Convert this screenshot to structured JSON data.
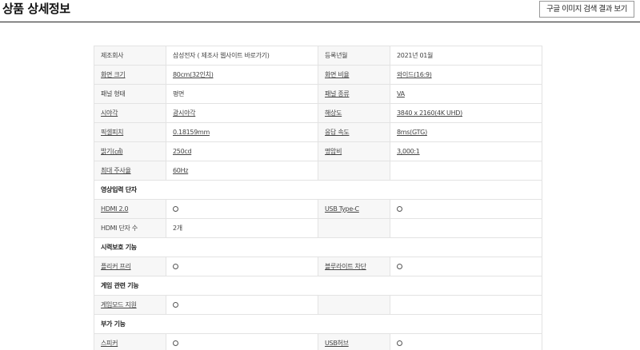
{
  "header": {
    "title": "상품 상세정보",
    "google_button": "구글 이미지 검색 결과 보기"
  },
  "spec_rows": [
    {
      "type": "row",
      "k1": "제조회사",
      "v1": "삼성전자 ( 제조사 웹사이트 바로가기)",
      "k2": "등록년월",
      "v2": "2021년 01월",
      "u": [
        false,
        false,
        false,
        false
      ]
    },
    {
      "type": "row",
      "k1": "화면 크기",
      "v1": "80cm(32인치)",
      "k2": "화면 비율",
      "v2": "와이드(16:9)",
      "u": [
        true,
        true,
        true,
        true
      ]
    },
    {
      "type": "row",
      "k1": "패널 형태",
      "v1": "평면",
      "k2": "패널 종류",
      "v2": "VA",
      "u": [
        false,
        false,
        true,
        true
      ]
    },
    {
      "type": "row",
      "k1": "시야각",
      "v1": "광시야각",
      "k2": "해상도",
      "v2": "3840 x 2160(4K UHD)",
      "u": [
        true,
        true,
        true,
        true
      ]
    },
    {
      "type": "row",
      "k1": "픽셀피치",
      "v1": "0.18159mm",
      "k2": "응답 속도",
      "v2": "8ms(GTG)",
      "u": [
        true,
        true,
        true,
        true
      ]
    },
    {
      "type": "row",
      "k1": "밝기(㎠)",
      "v1": "250cd",
      "k2": "명암비",
      "v2": "3,000:1",
      "u": [
        true,
        true,
        true,
        true
      ]
    },
    {
      "type": "row",
      "k1": "최대 주사율",
      "v1": "60Hz",
      "k2": "",
      "v2": "",
      "u": [
        true,
        true,
        false,
        false
      ]
    },
    {
      "type": "section",
      "label": "영상입력 단자"
    },
    {
      "type": "row",
      "k1": "HDMI 2.0",
      "v1": "○",
      "k2": "USB Type-C",
      "v2": "○",
      "u": [
        true,
        false,
        true,
        false
      ]
    },
    {
      "type": "row",
      "k1": "HDMI 단자 수",
      "v1": "2개",
      "k2": "",
      "v2": "",
      "u": [
        false,
        false,
        false,
        false
      ]
    },
    {
      "type": "section",
      "label": "시력보호 기능"
    },
    {
      "type": "row",
      "k1": "플리커 프리",
      "v1": "○",
      "k2": "블루라이트 차단",
      "v2": "○",
      "u": [
        true,
        false,
        true,
        false
      ]
    },
    {
      "type": "section",
      "label": "게임 관련 기능"
    },
    {
      "type": "row",
      "k1": "게임모드 지원",
      "v1": "○",
      "k2": "",
      "v2": "",
      "u": [
        true,
        false,
        false,
        false
      ]
    },
    {
      "type": "section",
      "label": "부가 기능"
    },
    {
      "type": "row",
      "k1": "스피커",
      "v1": "○",
      "k2": "USB허브",
      "v2": "○",
      "u": [
        true,
        false,
        true,
        false
      ]
    }
  ]
}
